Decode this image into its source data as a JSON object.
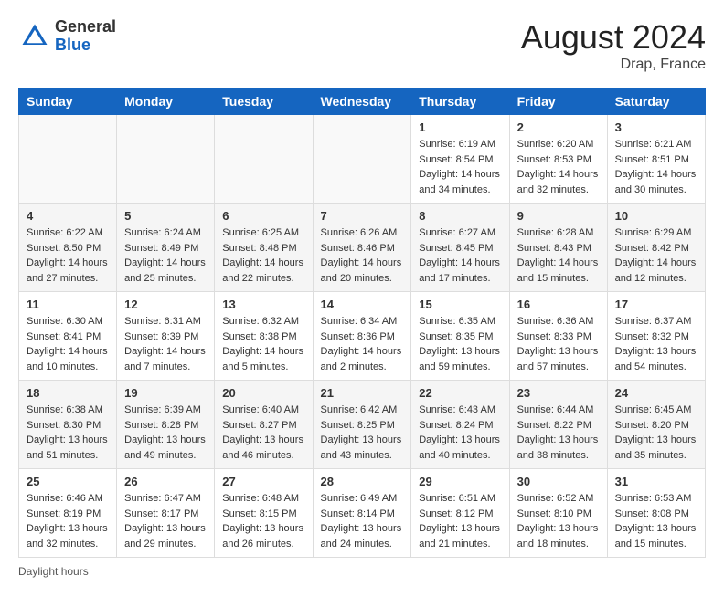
{
  "header": {
    "logo_general": "General",
    "logo_blue": "Blue",
    "month_title": "August 2024",
    "location": "Drap, France"
  },
  "days_of_week": [
    "Sunday",
    "Monday",
    "Tuesday",
    "Wednesday",
    "Thursday",
    "Friday",
    "Saturday"
  ],
  "weeks": [
    [
      {
        "day": "",
        "info": ""
      },
      {
        "day": "",
        "info": ""
      },
      {
        "day": "",
        "info": ""
      },
      {
        "day": "",
        "info": ""
      },
      {
        "day": "1",
        "info": "Sunrise: 6:19 AM\nSunset: 8:54 PM\nDaylight: 14 hours and 34 minutes."
      },
      {
        "day": "2",
        "info": "Sunrise: 6:20 AM\nSunset: 8:53 PM\nDaylight: 14 hours and 32 minutes."
      },
      {
        "day": "3",
        "info": "Sunrise: 6:21 AM\nSunset: 8:51 PM\nDaylight: 14 hours and 30 minutes."
      }
    ],
    [
      {
        "day": "4",
        "info": "Sunrise: 6:22 AM\nSunset: 8:50 PM\nDaylight: 14 hours and 27 minutes."
      },
      {
        "day": "5",
        "info": "Sunrise: 6:24 AM\nSunset: 8:49 PM\nDaylight: 14 hours and 25 minutes."
      },
      {
        "day": "6",
        "info": "Sunrise: 6:25 AM\nSunset: 8:48 PM\nDaylight: 14 hours and 22 minutes."
      },
      {
        "day": "7",
        "info": "Sunrise: 6:26 AM\nSunset: 8:46 PM\nDaylight: 14 hours and 20 minutes."
      },
      {
        "day": "8",
        "info": "Sunrise: 6:27 AM\nSunset: 8:45 PM\nDaylight: 14 hours and 17 minutes."
      },
      {
        "day": "9",
        "info": "Sunrise: 6:28 AM\nSunset: 8:43 PM\nDaylight: 14 hours and 15 minutes."
      },
      {
        "day": "10",
        "info": "Sunrise: 6:29 AM\nSunset: 8:42 PM\nDaylight: 14 hours and 12 minutes."
      }
    ],
    [
      {
        "day": "11",
        "info": "Sunrise: 6:30 AM\nSunset: 8:41 PM\nDaylight: 14 hours and 10 minutes."
      },
      {
        "day": "12",
        "info": "Sunrise: 6:31 AM\nSunset: 8:39 PM\nDaylight: 14 hours and 7 minutes."
      },
      {
        "day": "13",
        "info": "Sunrise: 6:32 AM\nSunset: 8:38 PM\nDaylight: 14 hours and 5 minutes."
      },
      {
        "day": "14",
        "info": "Sunrise: 6:34 AM\nSunset: 8:36 PM\nDaylight: 14 hours and 2 minutes."
      },
      {
        "day": "15",
        "info": "Sunrise: 6:35 AM\nSunset: 8:35 PM\nDaylight: 13 hours and 59 minutes."
      },
      {
        "day": "16",
        "info": "Sunrise: 6:36 AM\nSunset: 8:33 PM\nDaylight: 13 hours and 57 minutes."
      },
      {
        "day": "17",
        "info": "Sunrise: 6:37 AM\nSunset: 8:32 PM\nDaylight: 13 hours and 54 minutes."
      }
    ],
    [
      {
        "day": "18",
        "info": "Sunrise: 6:38 AM\nSunset: 8:30 PM\nDaylight: 13 hours and 51 minutes."
      },
      {
        "day": "19",
        "info": "Sunrise: 6:39 AM\nSunset: 8:28 PM\nDaylight: 13 hours and 49 minutes."
      },
      {
        "day": "20",
        "info": "Sunrise: 6:40 AM\nSunset: 8:27 PM\nDaylight: 13 hours and 46 minutes."
      },
      {
        "day": "21",
        "info": "Sunrise: 6:42 AM\nSunset: 8:25 PM\nDaylight: 13 hours and 43 minutes."
      },
      {
        "day": "22",
        "info": "Sunrise: 6:43 AM\nSunset: 8:24 PM\nDaylight: 13 hours and 40 minutes."
      },
      {
        "day": "23",
        "info": "Sunrise: 6:44 AM\nSunset: 8:22 PM\nDaylight: 13 hours and 38 minutes."
      },
      {
        "day": "24",
        "info": "Sunrise: 6:45 AM\nSunset: 8:20 PM\nDaylight: 13 hours and 35 minutes."
      }
    ],
    [
      {
        "day": "25",
        "info": "Sunrise: 6:46 AM\nSunset: 8:19 PM\nDaylight: 13 hours and 32 minutes."
      },
      {
        "day": "26",
        "info": "Sunrise: 6:47 AM\nSunset: 8:17 PM\nDaylight: 13 hours and 29 minutes."
      },
      {
        "day": "27",
        "info": "Sunrise: 6:48 AM\nSunset: 8:15 PM\nDaylight: 13 hours and 26 minutes."
      },
      {
        "day": "28",
        "info": "Sunrise: 6:49 AM\nSunset: 8:14 PM\nDaylight: 13 hours and 24 minutes."
      },
      {
        "day": "29",
        "info": "Sunrise: 6:51 AM\nSunset: 8:12 PM\nDaylight: 13 hours and 21 minutes."
      },
      {
        "day": "30",
        "info": "Sunrise: 6:52 AM\nSunset: 8:10 PM\nDaylight: 13 hours and 18 minutes."
      },
      {
        "day": "31",
        "info": "Sunrise: 6:53 AM\nSunset: 8:08 PM\nDaylight: 13 hours and 15 minutes."
      }
    ]
  ],
  "footer": {
    "note": "Daylight hours"
  }
}
